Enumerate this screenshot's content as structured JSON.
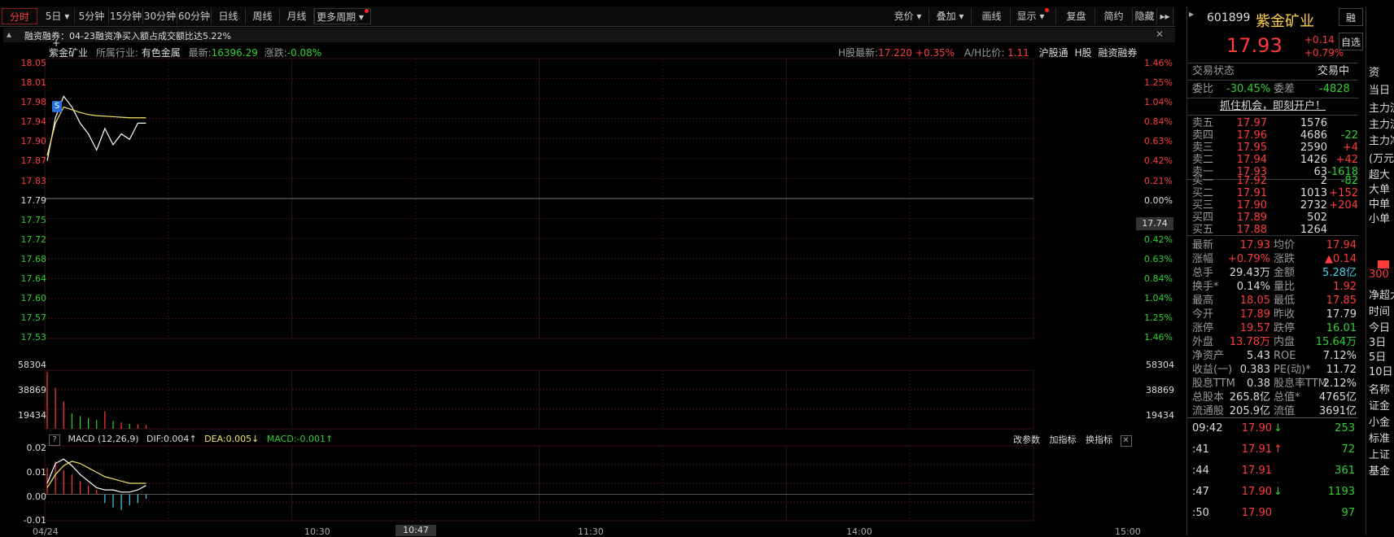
{
  "toolbar": {
    "periods": [
      "分时",
      "5日",
      "5分钟",
      "15分钟",
      "30分钟",
      "60分钟",
      "日线",
      "周线",
      "月线",
      "更多周期"
    ],
    "right_buttons": [
      "竞价",
      "叠加",
      "画线",
      "显示",
      "复盘",
      "简约",
      "隐藏"
    ]
  },
  "notice": {
    "text": "融资融券：04-23融资净买入额占成交额比达5.22%",
    "close": "✕"
  },
  "chart_header": {
    "name": "紫金矿业",
    "industry_label": "所属行业:",
    "industry": "有色金属",
    "latest_label": "最新:",
    "latest": "16396.29",
    "change_label": "涨跌:",
    "change": "-0.08%",
    "h_label": "H股最新:",
    "h_price": "17.220",
    "h_change": "+0.35%",
    "ah_label": "A/H比价:",
    "ah_value": "1.11",
    "tags": [
      "沪股通",
      "H股",
      "融资融券"
    ]
  },
  "price_axis": {
    "left": [
      "18.05",
      "18.01",
      "17.98",
      "17.94",
      "17.90",
      "17.87",
      "17.83",
      "17.79",
      "17.75",
      "17.72",
      "17.68",
      "17.64",
      "17.60",
      "17.57",
      "17.53"
    ],
    "right": [
      "1.46%",
      "1.25%",
      "1.04%",
      "0.84%",
      "0.63%",
      "0.42%",
      "0.21%",
      "0.00%",
      "0.42%",
      "0.63%",
      "0.84%",
      "1.04%",
      "1.25%",
      "1.46%"
    ],
    "cursor_label": "17.74",
    "marker": "S"
  },
  "volume_axis": {
    "labels": [
      "58304",
      "38869",
      "19434"
    ]
  },
  "macd": {
    "title": "MACD (12,26,9)",
    "dif": "DIF:0.004",
    "dea": "DEA:0.005",
    "macd": "MACD:-0.001",
    "arrow_up": "↑",
    "arrow_down": "↓",
    "axis": [
      "0.02",
      "0.01",
      "0.00",
      "-0.01"
    ],
    "actions": [
      "改参数",
      "加指标",
      "换指标"
    ],
    "help": "?",
    "close": "✕"
  },
  "time_axis": {
    "labels": [
      "04/24",
      "10:30",
      "10:47",
      "11:30",
      "14:00",
      "15:00"
    ]
  },
  "chart_data": {
    "type": "line",
    "x": [
      "09:30",
      "09:31",
      "09:32",
      "09:33",
      "09:34",
      "09:35",
      "09:36",
      "09:37",
      "09:38",
      "09:39",
      "09:40",
      "09:41",
      "09:42"
    ],
    "series": [
      {
        "values": [
          17.86,
          17.94,
          17.98,
          17.96,
          17.93,
          17.91,
          17.88,
          17.92,
          17.89,
          17.91,
          17.9,
          17.93,
          17.93
        ]
      },
      {
        "values": [
          17.87,
          17.93,
          17.96,
          17.955,
          17.95,
          17.946,
          17.944,
          17.943,
          17.942,
          17.941,
          17.94,
          17.94,
          17.94
        ]
      }
    ],
    "volumes": [
      58304,
      42000,
      28000,
      16000,
      13000,
      11000,
      9000,
      18000,
      8000,
      6500,
      5000,
      4500,
      4000
    ],
    "macd_hist": [
      0.012,
      0.015,
      0.011,
      0.009,
      0.006,
      0.004,
      0.002,
      -0.004,
      -0.006,
      -0.007,
      -0.005,
      -0.004,
      -0.002
    ],
    "dif": [
      0.005,
      0.014,
      0.016,
      0.013,
      0.009,
      0.006,
      0.003,
      0.002,
      0.002,
      0.001,
      0.001,
      0.002,
      0.004
    ],
    "dea": [
      0.003,
      0.009,
      0.013,
      0.015,
      0.014,
      0.012,
      0.01,
      0.008,
      0.007,
      0.006,
      0.005,
      0.005,
      0.005
    ],
    "ylim": [
      17.53,
      18.05
    ]
  },
  "quote": {
    "code": "601899",
    "name": "紫金矿业",
    "price": "17.93",
    "change": "+0.14",
    "change_pct": "+0.79%",
    "btn_rong": "融",
    "btn_zixuan": "自选",
    "status_label": "交易状态",
    "status": "交易中",
    "weibi_label": "委比",
    "weibi": "-30.45%",
    "weicha_label": "委差",
    "weicha": "-4828",
    "promo": "抓住机会，即刻开户！",
    "asks": [
      {
        "label": "卖五",
        "price": "17.97",
        "vol": "1576",
        "chg": ""
      },
      {
        "label": "卖四",
        "price": "17.96",
        "vol": "4686",
        "chg": "-22"
      },
      {
        "label": "卖三",
        "price": "17.95",
        "vol": "2590",
        "chg": "+4"
      },
      {
        "label": "卖二",
        "price": "17.94",
        "vol": "1426",
        "chg": "+42"
      },
      {
        "label": "卖一",
        "price": "17.93",
        "vol": "63",
        "chg": "-1618"
      }
    ],
    "bids": [
      {
        "label": "买一",
        "price": "17.92",
        "vol": "2",
        "chg": "-82"
      },
      {
        "label": "买二",
        "price": "17.91",
        "vol": "1013",
        "chg": "+152"
      },
      {
        "label": "买三",
        "price": "17.90",
        "vol": "2732",
        "chg": "+204"
      },
      {
        "label": "买四",
        "price": "17.89",
        "vol": "502",
        "chg": ""
      },
      {
        "label": "买五",
        "price": "17.88",
        "vol": "1264",
        "chg": ""
      }
    ],
    "stats": [
      {
        "l1": "最新",
        "v1": "17.93",
        "l2": "均价",
        "v2": "17.94"
      },
      {
        "l1": "涨幅",
        "v1": "+0.79%",
        "l2": "涨跌",
        "v2": "▲0.14"
      },
      {
        "l1": "总手",
        "v1": "29.43万",
        "l2": "金额",
        "v2": "5.28亿"
      },
      {
        "l1": "换手*",
        "v1": "0.14%",
        "l2": "量比",
        "v2": "1.92"
      },
      {
        "l1": "最高",
        "v1": "18.05",
        "l2": "最低",
        "v2": "17.85"
      },
      {
        "l1": "今开",
        "v1": "17.89",
        "l2": "昨收",
        "v2": "17.79"
      },
      {
        "l1": "涨停",
        "v1": "19.57",
        "l2": "跌停",
        "v2": "16.01"
      },
      {
        "l1": "外盘",
        "v1": "13.78万",
        "l2": "内盘",
        "v2": "15.64万"
      },
      {
        "l1": "净资产",
        "v1": "5.43",
        "l2": "ROE",
        "v2": "7.12%"
      },
      {
        "l1": "收益(一)",
        "v1": "0.383",
        "l2": "PE(动)*",
        "v2": "11.72"
      },
      {
        "l1": "股息TTM",
        "v1": "0.38",
        "l2": "股息率TTM",
        "v2": "2.12%"
      },
      {
        "l1": "总股本",
        "v1": "265.8亿",
        "l2": "总值*",
        "v2": "4765亿"
      },
      {
        "l1": "流通股",
        "v1": "205.9亿",
        "l2": "流值",
        "v2": "3691亿"
      }
    ],
    "ticks": [
      {
        "time": "09:42",
        "price": "17.90",
        "dir": "↓",
        "vol": "253"
      },
      {
        "time": ":41",
        "price": "17.91",
        "dir": "↑",
        "vol": "72"
      },
      {
        "time": ":44",
        "price": "17.91",
        "dir": "",
        "vol": "361"
      },
      {
        "time": ":47",
        "price": "17.90",
        "dir": "↓",
        "vol": "1193"
      },
      {
        "time": ":50",
        "price": "17.90",
        "dir": "",
        "vol": "97"
      }
    ]
  },
  "side_column": {
    "items": [
      "资",
      "当日",
      "主力流",
      "主力流",
      "主力净",
      "(万元)",
      "超大",
      "大单",
      "中单",
      "小单",
      "300",
      "净超大",
      "时间",
      "今日",
      "3日",
      "5日",
      "10日",
      "名称",
      "证金",
      "小金",
      "标准",
      "上证",
      "基金"
    ]
  }
}
